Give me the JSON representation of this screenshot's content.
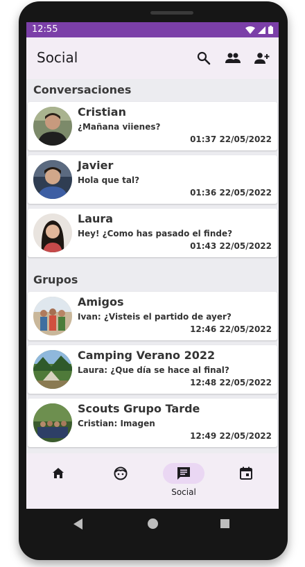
{
  "status_bar": {
    "time": "12:55",
    "icons": [
      "wifi-icon",
      "signal-icon",
      "battery-icon"
    ]
  },
  "app_bar": {
    "title": "Social",
    "actions": [
      "search-icon",
      "people-icon",
      "add-person-icon"
    ]
  },
  "sections": [
    {
      "title": "Conversaciones",
      "items": [
        {
          "name": "Cristian",
          "message": "¿Mañana viienes?",
          "timestamp": "01:37 22/05/2022"
        },
        {
          "name": "Javier",
          "message": "Hola que tal?",
          "timestamp": "01:36 22/05/2022"
        },
        {
          "name": "Laura",
          "message": "Hey! ¿Como has pasado el finde?",
          "timestamp": "01:43 22/05/2022"
        }
      ]
    },
    {
      "title": "Grupos",
      "items": [
        {
          "name": "Amigos",
          "message": "Ivan: ¿Visteis el partido de ayer?",
          "timestamp": "12:46 22/05/2022"
        },
        {
          "name": "Camping Verano 2022",
          "message": "Laura: ¿Que día se hace al final?",
          "timestamp": "12:48 22/05/2022"
        },
        {
          "name": "Scouts Grupo Tarde",
          "message": "Cristian: Imagen",
          "timestamp": "12:49 22/05/2022"
        }
      ]
    }
  ],
  "bottom_nav": {
    "items": [
      {
        "icon": "home-icon",
        "label": ""
      },
      {
        "icon": "face-icon",
        "label": ""
      },
      {
        "icon": "chat-icon",
        "label": "Social",
        "selected": true
      },
      {
        "icon": "calendar-icon",
        "label": ""
      }
    ]
  },
  "colors": {
    "status_bar": "#7b3fa8",
    "app_bar": "#f3edf5",
    "nav_pill": "#ead7f3",
    "background": "#ececf0"
  }
}
